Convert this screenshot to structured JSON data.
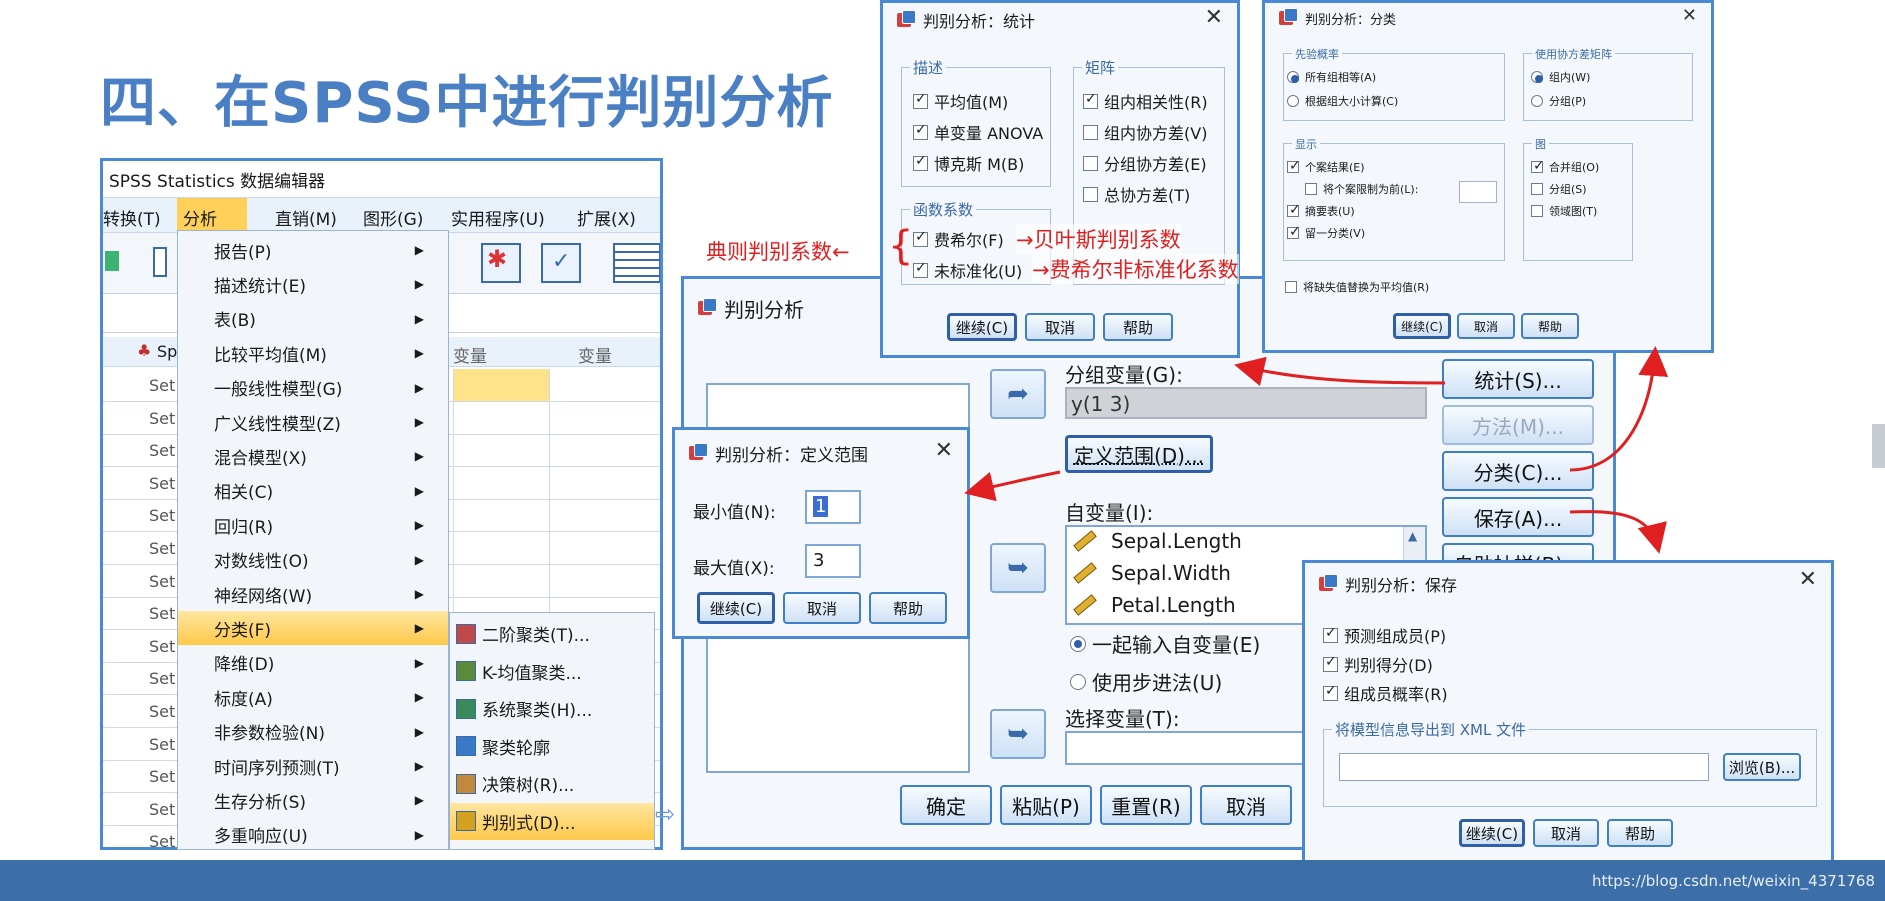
{
  "slide_title": "四、在SPSS中进行判别分析",
  "editor": {
    "title": "SPSS Statistics 数据编辑器",
    "menubar": [
      "转换(T)",
      "分析(A)",
      "直销(M)",
      "图形(G)",
      "实用程序(U)",
      "扩展(X)"
    ],
    "col_headers": [
      "变量",
      "变量"
    ],
    "row_label": "Set",
    "first_col_header": "Sp"
  },
  "analysis_menu": {
    "items": [
      "报告(P)",
      "描述统计(E)",
      "表(B)",
      "比较平均值(M)",
      "一般线性模型(G)",
      "广义线性模型(Z)",
      "混合模型(X)",
      "相关(C)",
      "回归(R)",
      "对数线性(O)",
      "神经网络(W)",
      "分类(F)",
      "降维(D)",
      "标度(A)",
      "非参数检验(N)",
      "时间序列预测(T)",
      "生存分析(S)",
      "多重响应(U)"
    ],
    "highlighted_index": 11
  },
  "classify_submenu": {
    "items": [
      "二阶聚类(T)...",
      "K-均值聚类...",
      "系统聚类(H)...",
      "聚类轮廓",
      "决策树(R)...",
      "判别式(D)..."
    ],
    "highlighted_index": 5
  },
  "annotations": {
    "canonical": "典则判别系数←",
    "bayes": "→贝叶斯判别系数",
    "fisher_unstd": "→费希尔非标准化系数"
  },
  "main_dialog": {
    "title": "判别分析",
    "grouping_label": "分组变量(G):",
    "grouping_value": "y(1 3)",
    "define_range_btn": "定义范围(D)...",
    "independents_label": "自变量(I):",
    "independents": [
      "Sepal.Length",
      "Sepal.Width",
      "Petal.Length"
    ],
    "enter_together": "一起输入自变量(E)",
    "stepwise": "使用步进法(U)",
    "selection_label": "选择变量(T):",
    "side_buttons": [
      "统计(S)...",
      "方法(M)...",
      "分类(C)...",
      "保存(A)...",
      "自助抽样(B)..."
    ],
    "bottom_buttons": [
      "确定",
      "粘贴(P)",
      "重置(R)",
      "取消"
    ]
  },
  "range_dialog": {
    "title": "判别分析：定义范围",
    "min_label": "最小值(N):",
    "min_value": "1",
    "max_label": "最大值(X):",
    "max_value": "3",
    "buttons": [
      "继续(C)",
      "取消",
      "帮助"
    ]
  },
  "stats_dialog": {
    "title": "判别分析：统计",
    "desc_group": "描述",
    "desc_items": [
      "平均值(M)",
      "单变量 ANOVA",
      "博克斯 M(B)"
    ],
    "matrix_group": "矩阵",
    "matrix_items": [
      "组内相关性(R)",
      "组内协方差(V)",
      "分组协方差(E)",
      "总协方差(T)"
    ],
    "matrix_checked": [
      true,
      false,
      false,
      false
    ],
    "func_group": "函数系数",
    "func_items": [
      "费希尔(F)",
      "未标准化(U)"
    ],
    "buttons": [
      "继续(C)",
      "取消",
      "帮助"
    ]
  },
  "classify_dialog": {
    "title": "判别分析：分类",
    "prior_group": "先验概率",
    "prior_items": [
      "所有组相等(A)",
      "根据组大小计算(C)"
    ],
    "cov_group": "使用协方差矩阵",
    "cov_items": [
      "组内(W)",
      "分组(P)"
    ],
    "display_group": "显示",
    "display_items": [
      "个案结果(E)",
      "将个案限制为前(L):",
      "摘要表(U)",
      "留一分类(V)"
    ],
    "display_checked": [
      true,
      false,
      true,
      true
    ],
    "plot_group": "图",
    "plot_items": [
      "合并组(O)",
      "分组(S)",
      "领域图(T)"
    ],
    "plot_checked": [
      true,
      false,
      false
    ],
    "replace_missing": "将缺失值替换为平均值(R)",
    "buttons": [
      "继续(C)",
      "取消",
      "帮助"
    ]
  },
  "save_dialog": {
    "title": "判别分析：保存",
    "items": [
      "预测组成员(P)",
      "判别得分(D)",
      "组成员概率(R)"
    ],
    "xml_group": "将模型信息导出到 XML 文件",
    "browse": "浏览(B)...",
    "buttons": [
      "继续(C)",
      "取消",
      "帮助"
    ]
  },
  "footer_url": "https://blog.csdn.net/weixin_4371768",
  "colors": {
    "accent": "#4a7fc4",
    "footer": "#3c6fa8",
    "annotation": "#e02020",
    "highlight": "#ffd15a"
  }
}
